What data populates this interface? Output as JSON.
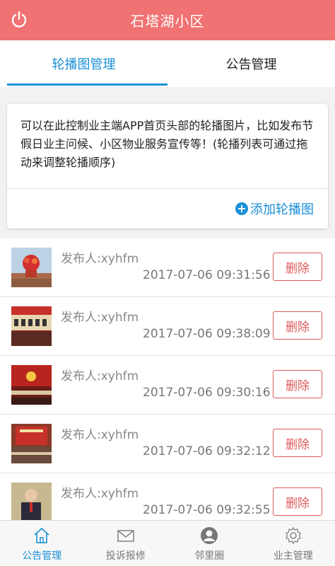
{
  "header": {
    "title": "石塔湖小区",
    "power_icon": "power-icon"
  },
  "tabs": [
    {
      "label": "轮播图管理",
      "active": true
    },
    {
      "label": "公告管理",
      "active": false
    }
  ],
  "info_card": {
    "description": "可以在此控制业主端APP首页头部的轮播图片，比如发布节假日业主问候、小区物业服务宣传等！(轮播列表可通过拖动来调整轮播顺序)",
    "add_label": "添加轮播图"
  },
  "banners": [
    {
      "publisher": "发布人:xyhfm",
      "time": "2017-07-06 09:31:56",
      "delete_label": "删除"
    },
    {
      "publisher": "发布人:xyhfm",
      "time": "2017-07-06 09:38:09",
      "delete_label": "删除"
    },
    {
      "publisher": "发布人:xyhfm",
      "time": "2017-07-06 09:30:16",
      "delete_label": "删除"
    },
    {
      "publisher": "发布人:xyhfm",
      "time": "2017-07-06 09:32:12",
      "delete_label": "删除"
    },
    {
      "publisher": "发布人:xyhfm",
      "time": "2017-07-06 09:32:55",
      "delete_label": "删除"
    }
  ],
  "bottom_nav": [
    {
      "label": "公告管理",
      "icon": "home-icon",
      "active": true
    },
    {
      "label": "投诉报修",
      "icon": "mail-icon",
      "active": false
    },
    {
      "label": "邻里圈",
      "icon": "user-circle-icon",
      "active": false
    },
    {
      "label": "业主管理",
      "icon": "gear-icon",
      "active": false
    }
  ],
  "colors": {
    "accent": "#1b8fd6",
    "header": "#f07272",
    "delete": "#e05a5a"
  }
}
